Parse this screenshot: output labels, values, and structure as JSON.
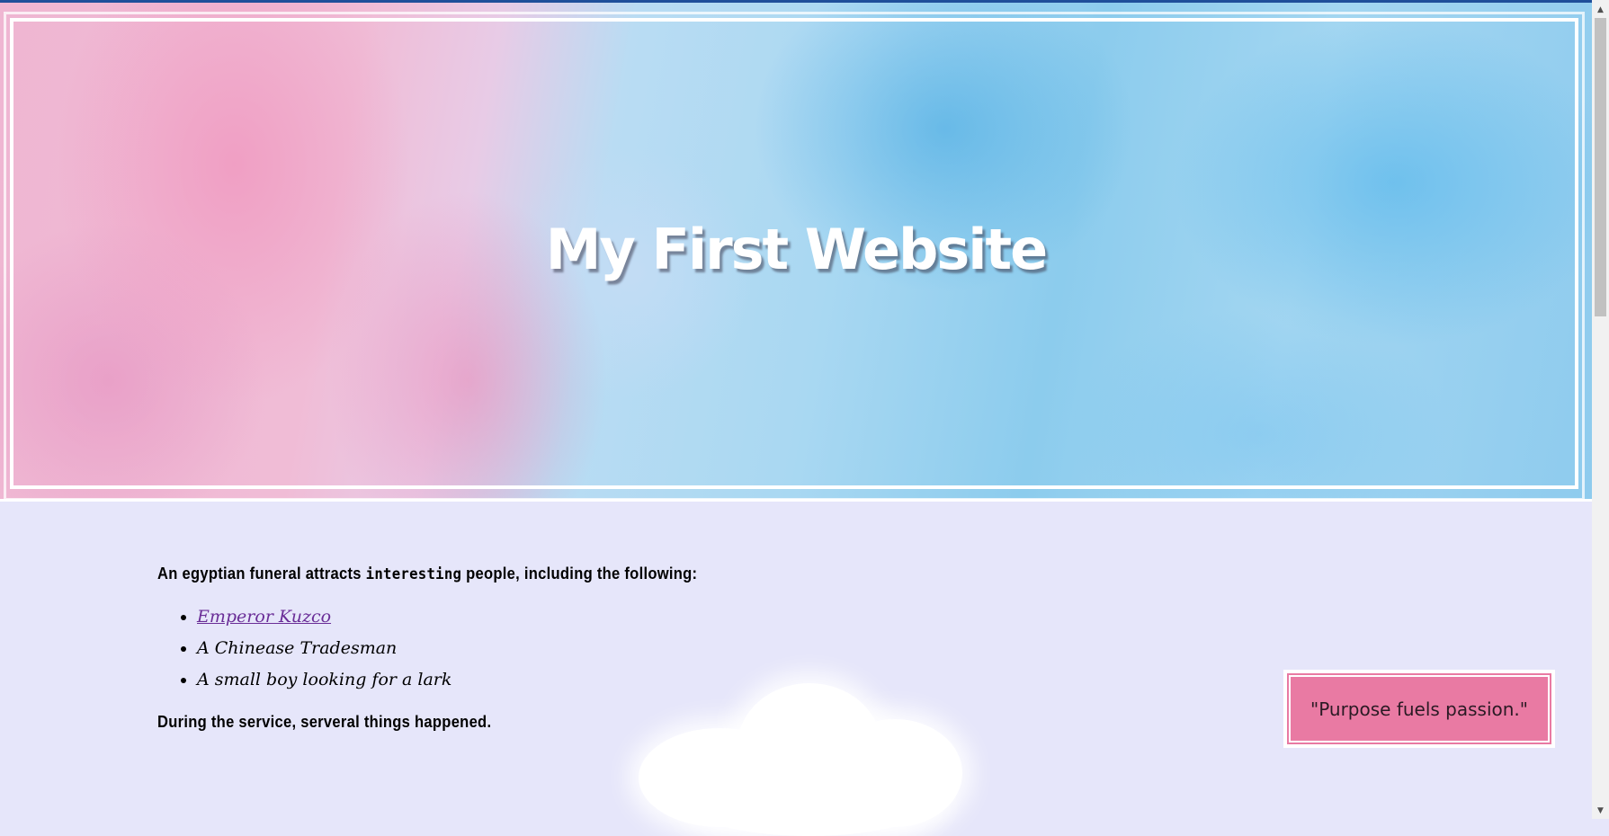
{
  "hero": {
    "title": "My First Website"
  },
  "main": {
    "intro_before": "An egyptian funeral attracts ",
    "intro_emphasis": "interesting",
    "intro_after": " people, including the following:",
    "list_items": [
      {
        "label": "Emperor Kuzco",
        "is_link": true
      },
      {
        "label": "A Chinease Tradesman",
        "is_link": false
      },
      {
        "label": "A small boy looking for a lark",
        "is_link": false
      }
    ],
    "closing": "During the service, serveral things happened."
  },
  "quote": {
    "text": "\"Purpose fuels passion.\""
  },
  "colors": {
    "page_background": "#e6e6fa",
    "quote_background": "#e97aa3",
    "link": "#6a2d97"
  }
}
